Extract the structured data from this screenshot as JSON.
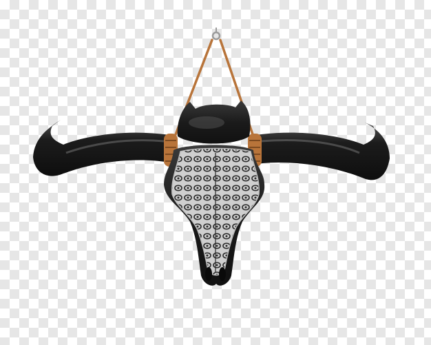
{
  "image": {
    "background": "transparency-checkerboard",
    "subject": "decorative-bull-skull-wall-hanging",
    "colors": {
      "skull_black": "#1a1a1a",
      "skull_highlight": "#4a4a4a",
      "filigree_silver": "#d9d9d9",
      "leather_strap": "#b8743a",
      "hook_metal": "#9a9a9a"
    }
  }
}
